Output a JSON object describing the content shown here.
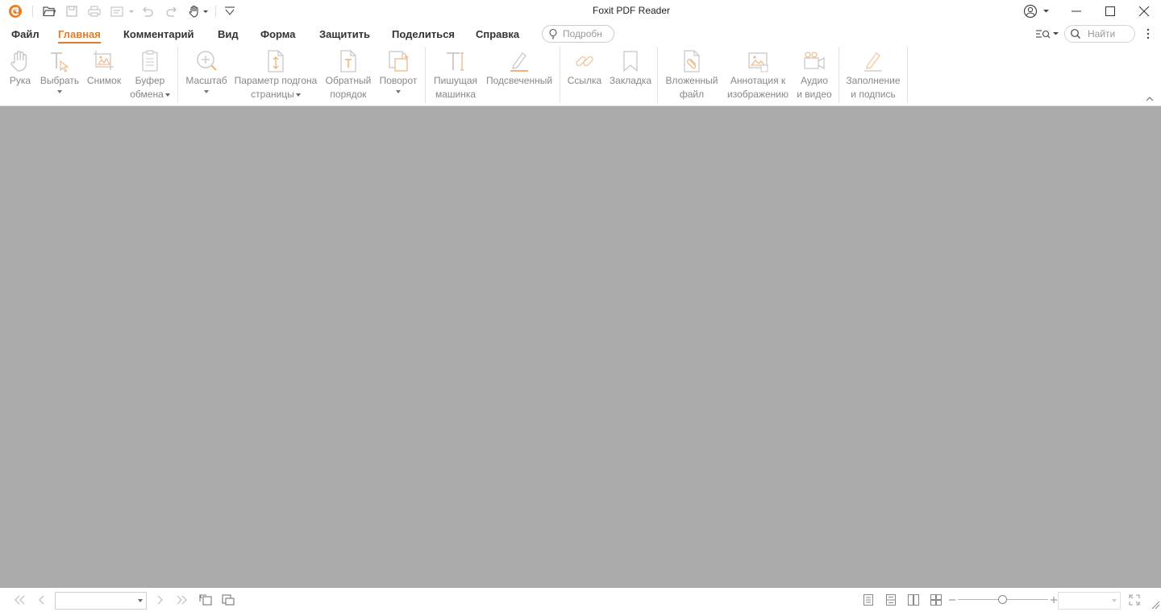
{
  "app": {
    "title": "Foxit PDF Reader"
  },
  "quick_access": [
    {
      "icon": "foxit-logo-icon"
    },
    {
      "icon": "open-folder-icon"
    },
    {
      "icon": "save-icon"
    },
    {
      "icon": "print-icon"
    },
    {
      "icon": "properties-icon"
    },
    {
      "icon": "undo-icon"
    },
    {
      "icon": "redo-icon"
    },
    {
      "icon": "hand-icon"
    },
    {
      "icon": "customize-icon"
    }
  ],
  "menu": {
    "tabs": [
      {
        "label": "Файл",
        "active": false
      },
      {
        "label": "Главная",
        "active": true
      },
      {
        "label": "Комментарий",
        "active": false
      },
      {
        "label": "Вид",
        "active": false
      },
      {
        "label": "Форма",
        "active": false
      },
      {
        "label": "Защитить",
        "active": false
      },
      {
        "label": "Поделиться",
        "active": false
      },
      {
        "label": "Справка",
        "active": false
      }
    ],
    "tell_me_placeholder": "Подробн",
    "search_placeholder": "Найти"
  },
  "ribbon": {
    "hand": {
      "label": "Рука"
    },
    "select": {
      "label": "Выбрать"
    },
    "snapshot": {
      "label": "Снимок"
    },
    "clipboard": {
      "line1": "Буфер",
      "line2": "обмена"
    },
    "zoom": {
      "label": "Масштаб"
    },
    "page_fit": {
      "line1": "Параметр подгона",
      "line2": "страницы"
    },
    "reverse": {
      "line1": "Обратный",
      "line2": "порядок"
    },
    "rotate": {
      "label": "Поворот"
    },
    "typewriter": {
      "line1": "Пишущая",
      "line2": "машинка"
    },
    "highlight": {
      "label": "Подсвеченный"
    },
    "link": {
      "label": "Ссылка"
    },
    "bookmark": {
      "label": "Закладка"
    },
    "attachment": {
      "line1": "Вложенный",
      "line2": "файл"
    },
    "image_annotation": {
      "line1": "Аннотация к",
      "line2": "изображению"
    },
    "audio_video": {
      "line1": "Аудио",
      "line2": "и видео"
    },
    "fill_sign": {
      "line1": "Заполнение",
      "line2": "и подпись"
    }
  },
  "statusbar": {
    "page_value": "",
    "zoom_value": ""
  },
  "colors": {
    "accent": "#e07d2c",
    "doc_background": "#ababab",
    "icon_disabled": "#c8c8c8"
  }
}
